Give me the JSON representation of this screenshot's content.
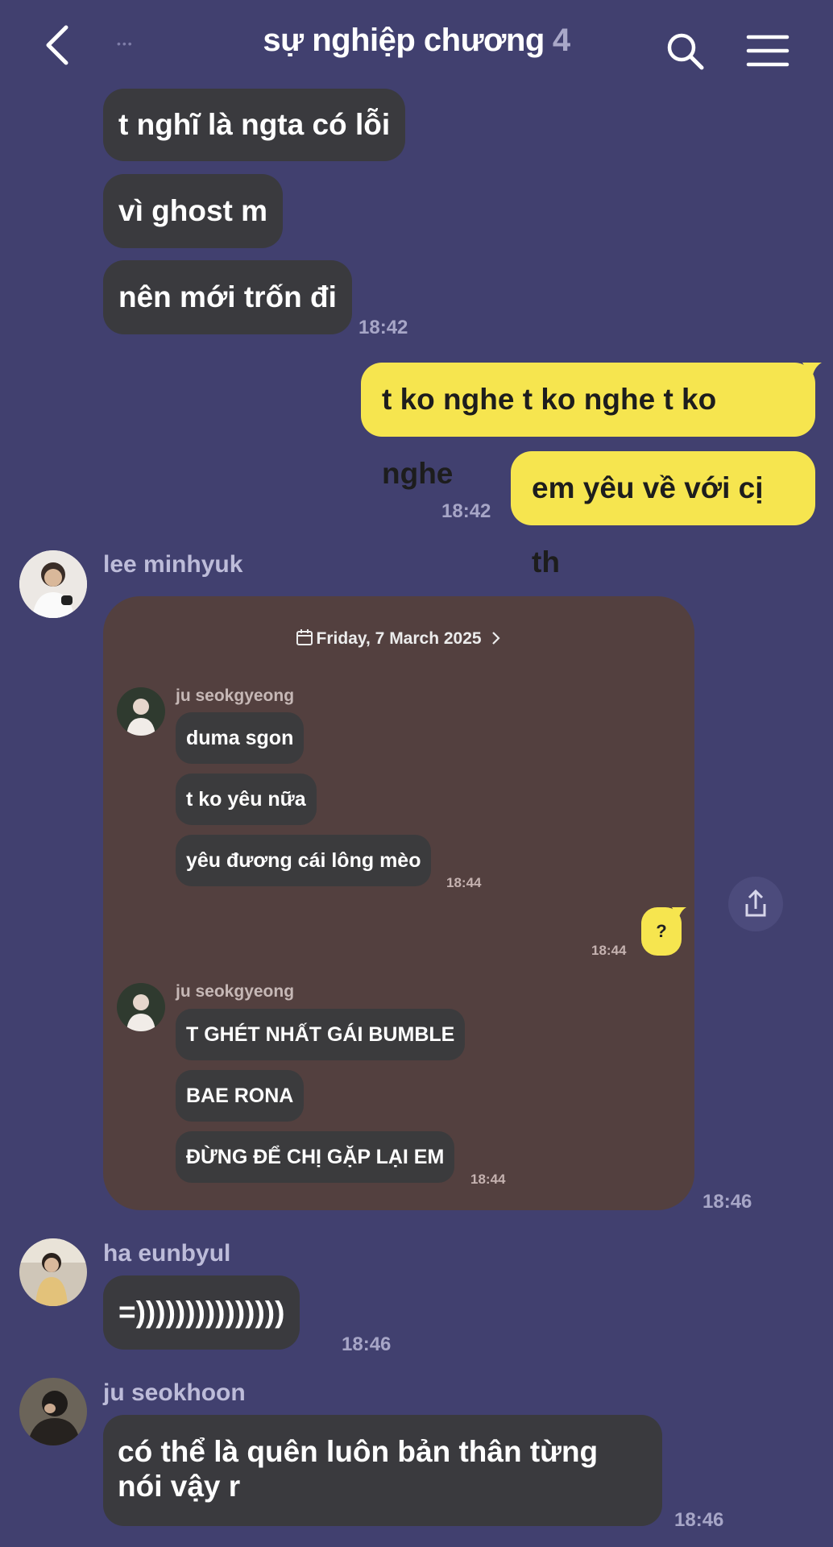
{
  "header": {
    "title": "sự nghiệp chương",
    "member_count": "4",
    "back_icon": "chevron-left-icon",
    "search_icon": "search-icon",
    "menu_icon": "hamburger-menu-icon"
  },
  "messages": {
    "m1": "t nghĩ là ngta có lỗi",
    "m2": "vì ghost m",
    "m3": "nên mới trốn đi",
    "t1": "18:42",
    "o1": "t ko nghe t ko nghe t ko nghe",
    "o2": "em yêu về với cị th",
    "t2": "18:42",
    "sender1": "lee minhyuk",
    "t3": "18:46",
    "sender2": "ha eunbyul",
    "m4": "=)))))))))))))))",
    "t4": "18:46",
    "sender3": "ju seokhoon",
    "m5": "có thể là quên luôn bản thân từng nói vậy r",
    "t5": "18:46"
  },
  "screenshot": {
    "date": "Friday, 7 March 2025",
    "sender_a": "ju seokgyeong",
    "a1": "duma sgon",
    "a2": "t ko yêu nữa",
    "a3": "yêu đương cái lông mèo",
    "ta": "18:44",
    "reply": "?",
    "treply": "18:44",
    "sender_b": "ju seokgyeong",
    "b1": "T GHÉT NHẤT GÁI BUMBLE",
    "b2": "BAE RONA",
    "b3": "ĐỪNG ĐỂ CHỊ GẶP LẠI EM",
    "tb": "18:44"
  },
  "colors": {
    "background": "#41406f",
    "incoming_bubble": "#3a3a3e",
    "outgoing_bubble": "#f6e54f",
    "card": "#53403f"
  },
  "share_icon": "share-icon"
}
